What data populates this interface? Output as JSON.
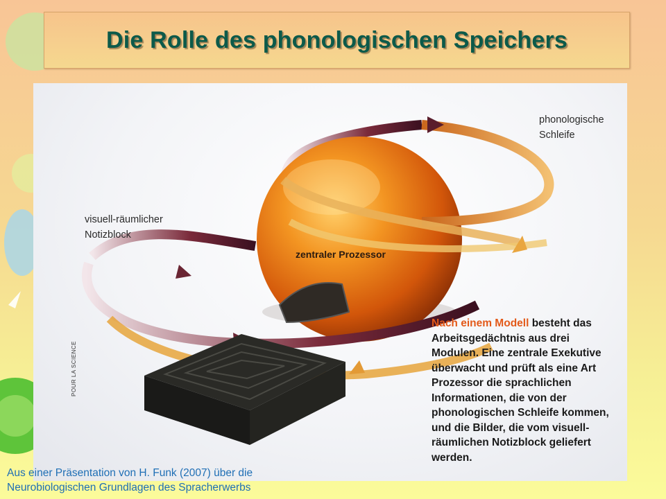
{
  "slide": {
    "title": "Die Rolle des phonologischen Speichers"
  },
  "figure": {
    "label_phonological_line1": "phonologische",
    "label_phonological_line2": "Schleife",
    "label_visuospatial_line1": "visuell-räumlicher",
    "label_visuospatial_line2": "Notizblock",
    "label_central": "zentraler Prozessor",
    "caption_highlight": "Nach einem Modell",
    "caption_rest": " besteht das Arbeitsgedächtnis aus drei Modulen. Eine zentrale Exekutive überwacht und prüft als eine Art Prozessor die sprachlichen Informationen, die von der phonologischen Schleife kommen, und die Bilder, die vom visuell-räumlichen Notizblock geliefert werden.",
    "credit": "POUR LA SCIENCE"
  },
  "source": {
    "line1": "Aus einer Präsentation von H. Funk (2007) über die",
    "line2": "Neurobiologischen Grundlagen des Spracherwerbs"
  },
  "colors": {
    "title": "#0c5a4a",
    "source_text": "#1f6fb5",
    "caption_highlight": "#e35a1a"
  }
}
